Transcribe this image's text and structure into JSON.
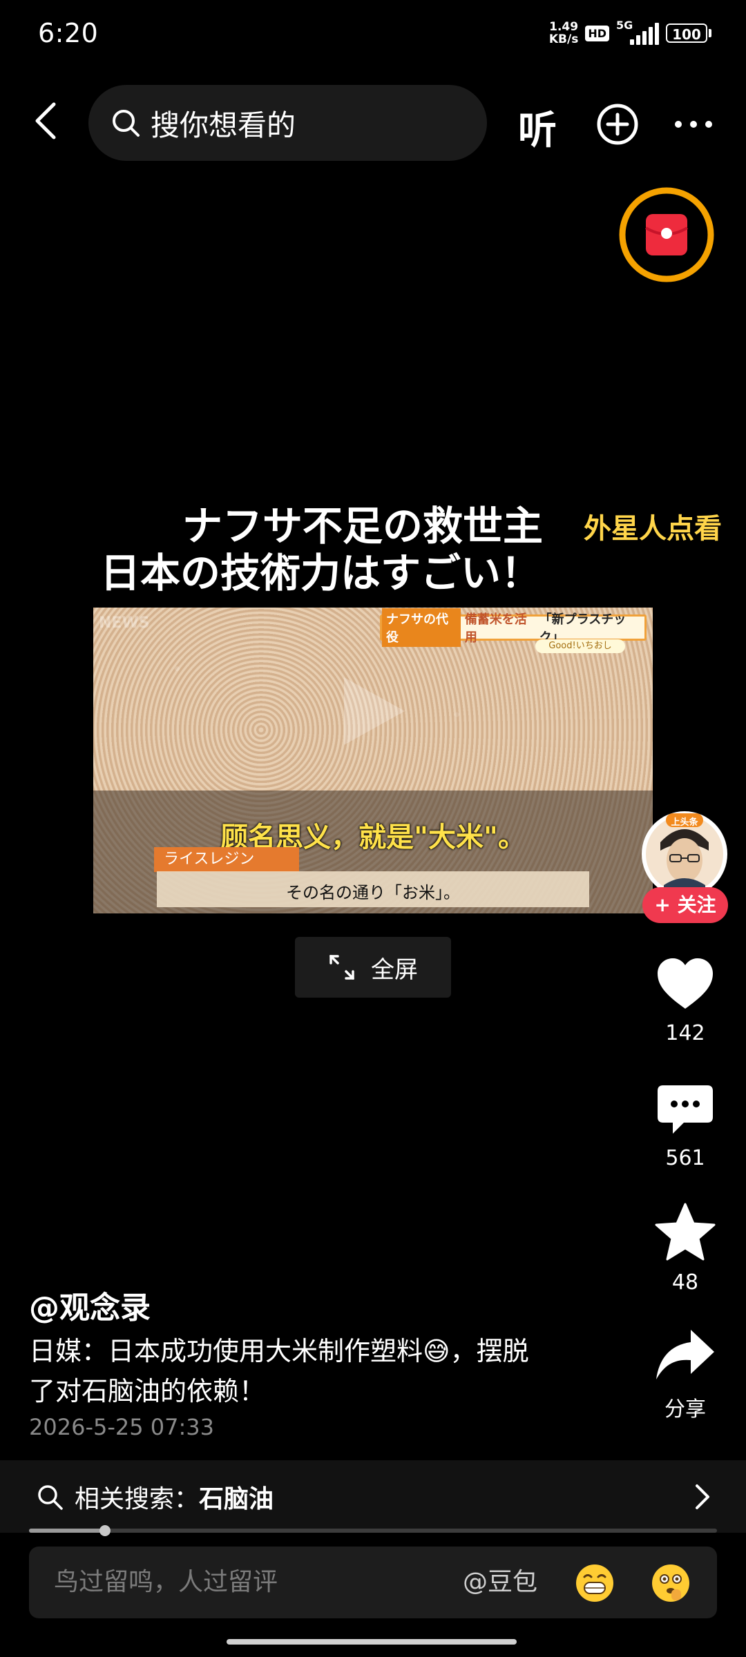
{
  "status_bar": {
    "time": "6:20",
    "net_speed_value": "1.49",
    "net_speed_unit": "KB/s",
    "hd": "HD",
    "network": "5G",
    "battery": "100"
  },
  "header": {
    "search_placeholder": "搜你想看的",
    "listen_label": "听"
  },
  "video": {
    "title_line1": "ナフサ不足の救世主",
    "title_line2": "日本の技術力はすごい！",
    "tag": "外星人点看",
    "overlay_badge": "ナフサの代役",
    "overlay_text": "備蓄米を活用",
    "overlay_text2": "「新プラスチック」",
    "overlay_sub": "Good!いちおし",
    "subtitle_cn": "顾名思义，就是\"大米\"。",
    "rice_label": "ライスレジン",
    "subtitle_jp": "その名の通り「お米」。",
    "fullscreen_label": "全屏"
  },
  "actions": {
    "follow_label": "+ 关注",
    "avatar_badge": "上头条",
    "likes": "142",
    "comments": "561",
    "favorites": "48",
    "share_label": "分享"
  },
  "post": {
    "author": "@观念录",
    "text_line1": "日媒：日本成功使用大米制作塑料😅，摆脱",
    "text_line2": "了对石脑油的依赖！",
    "date": "2026-5-25 07:33"
  },
  "related": {
    "prefix": "相关搜索：",
    "term": "石脑油"
  },
  "progress": {
    "fraction": 0.11
  },
  "comment_bar": {
    "placeholder": "鸟过留鸣，人过留评",
    "mention": "@豆包"
  },
  "colors": {
    "follow_red": "#f0394f",
    "tag_yellow": "#ffd54a",
    "red_packet_ring": "#f5a200"
  }
}
